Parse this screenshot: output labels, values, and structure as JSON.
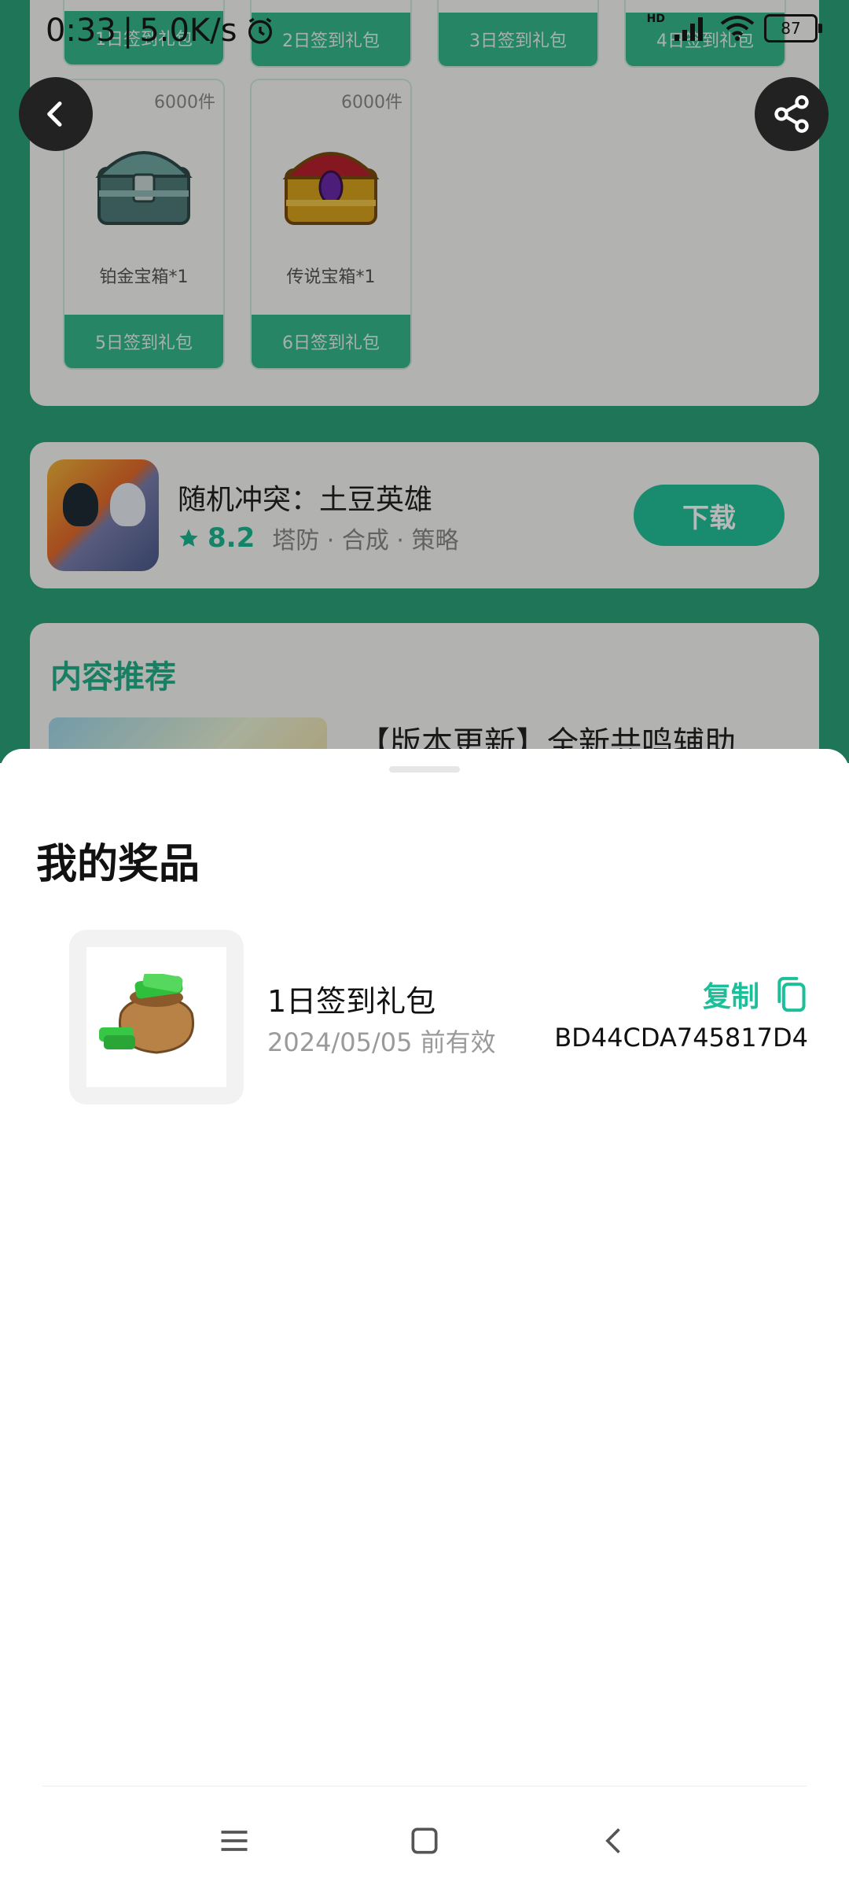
{
  "status_bar": {
    "time": "0:33",
    "speed": "5.0K/s",
    "network_badge": "HD",
    "battery": "87"
  },
  "gifts": {
    "top_row": [
      {
        "label": "1日签到礼包"
      },
      {
        "label": "2日签到礼包"
      },
      {
        "label": "3日签到礼包"
      },
      {
        "label": "4日签到礼包"
      }
    ],
    "row2": [
      {
        "count": "6000件",
        "name": "铂金宝箱*1",
        "label": "5日签到礼包"
      },
      {
        "count": "6000件",
        "name": "传说宝箱*1",
        "label": "6日签到礼包"
      }
    ]
  },
  "game": {
    "title": "随机冲突：土豆英雄",
    "rating": "8.2",
    "tags": "塔防 · 合成 · 策略",
    "download_label": "下载"
  },
  "recommend": {
    "heading": "内容推荐",
    "article_title": "【版本更新】全新共鸣辅助"
  },
  "sheet": {
    "title": "我的奖品",
    "prize": {
      "name": "1日签到礼包",
      "expiry": "2024/05/05 前有效",
      "copy_label": "复制",
      "code": "BD44CDA745817D4"
    }
  },
  "colors": {
    "accent": "#1cbf9a",
    "page_green": "#2aa37a",
    "card_bg": "#f7f7f4"
  }
}
